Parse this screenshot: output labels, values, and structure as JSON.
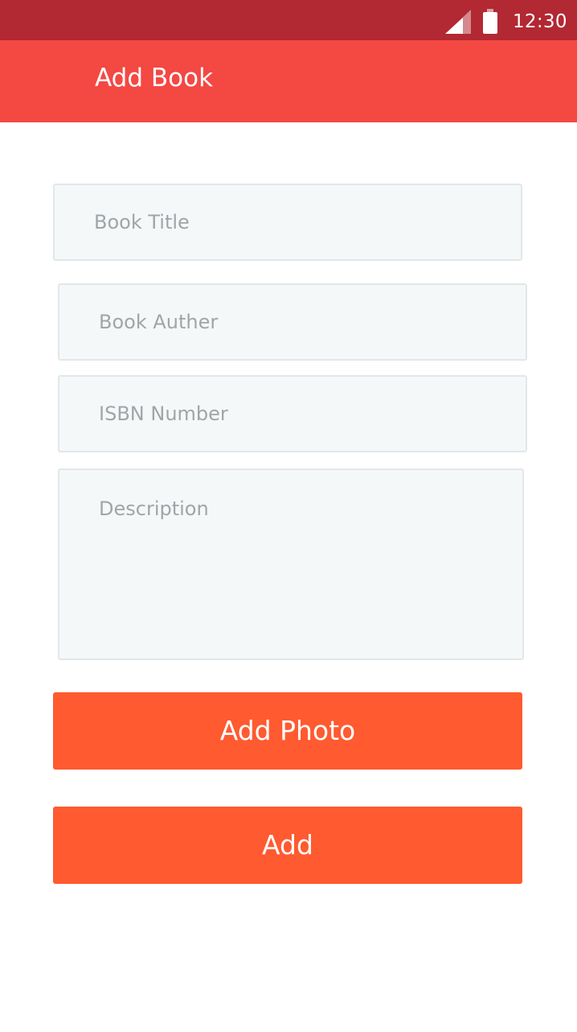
{
  "status_bar": {
    "time": "12:30",
    "signal_icon": "cell-signal-icon",
    "battery_icon": "battery-icon",
    "color": "#b22833"
  },
  "app_bar": {
    "title": "Add Book",
    "color": "#f44843"
  },
  "form": {
    "book_title": {
      "placeholder": "Book Title",
      "value": ""
    },
    "book_author": {
      "placeholder": "Book Auther",
      "value": ""
    },
    "isbn": {
      "placeholder": "ISBN Number",
      "value": ""
    },
    "description": {
      "placeholder": "Description",
      "value": ""
    }
  },
  "actions": {
    "add_photo_label": "Add Photo",
    "add_label": "Add",
    "button_color": "#ff5a30"
  }
}
